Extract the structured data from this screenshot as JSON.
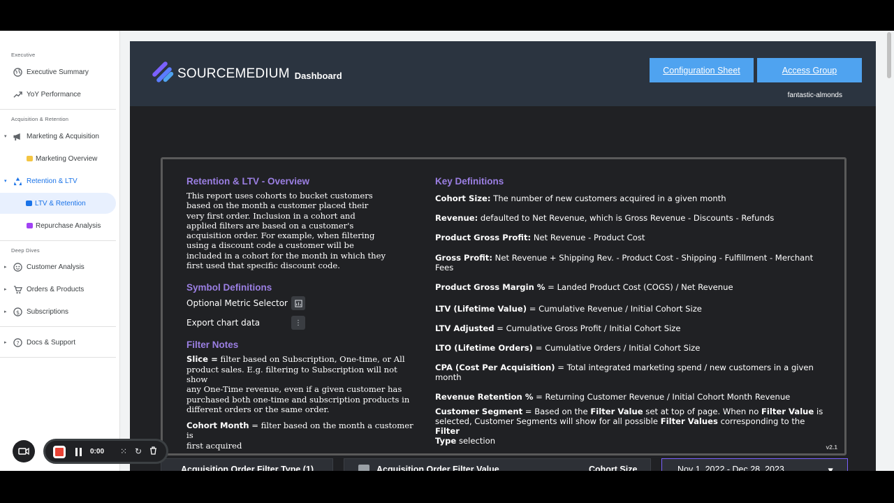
{
  "sidebar": {
    "sections": {
      "executive": "Executive",
      "acquisition": "Acquisition & Retention",
      "deep": "Deep Dives"
    },
    "items": {
      "exec_summary": "Executive Summary",
      "yoy": "YoY Performance",
      "mkt_acq": "Marketing & Acquisition",
      "mkt_overview": "Marketing Overview",
      "ret_ltv": "Retention & LTV",
      "ltv_ret": "LTV & Retention",
      "repurchase": "Repurchase Analysis",
      "customer": "Customer Analysis",
      "orders": "Orders & Products",
      "subs": "Subscriptions",
      "docs": "Docs & Support"
    }
  },
  "header": {
    "brand": "SOURCEMEDIUM",
    "brand_sub": "Dashboard",
    "config_btn": "Configuration Sheet",
    "access_btn": "Access Group",
    "account": "fantastic-almonds"
  },
  "overview": {
    "title": "Retention & LTV - Overview",
    "lines": [
      "This report uses cohorts to bucket customers",
      "based on the month a customer placed their",
      "very first order. Inclusion in a cohort and",
      "applied filters are based on a customer's",
      "acquisition order. For example, when filtering",
      "using a discount code a customer will be",
      "included in a cohort for the month in which they",
      "first used that specific discount code."
    ]
  },
  "symbols": {
    "title": "Symbol Definitions",
    "optional": "Optional Metric Selector",
    "export": "Export chart data"
  },
  "filters": {
    "title": "Filter Notes",
    "slice_label": "Slice =",
    "slice_lines": [
      " filter based on Subscription, One-time, or All",
      "product sales.  E.g. filtering to Subscription will not show",
      "any One-Time revenue, even if a given customer has",
      "purchased both one-time and subscription products in",
      "different orders or the same order."
    ],
    "cohort_label": "Cohort Month",
    "cohort_lines": [
      " = filter based on the month a customer is",
      "first acquired"
    ]
  },
  "definitions": {
    "title": "Key Definitions",
    "items": [
      {
        "term": "Cohort Size:",
        "text": " The number of new customers acquired in a given month"
      },
      {
        "term": "Revenue:",
        "text": " defaulted to Net Revenue, which is Gross Revenue - Discounts - Refunds"
      },
      {
        "term": "Product Gross Profit:",
        "text": " Net Revenue - Product Cost"
      },
      {
        "term": "Gross Profit:",
        "text": " Net Revenue + Shipping Rev. - Product Cost - Shipping - Fulfillment - Merchant Fees"
      },
      {
        "term": "Product Gross Margin %",
        "text": " = Landed Product Cost (COGS) / Net Revenue"
      },
      {
        "term": "LTV (Lifetime Value)",
        "text": "  = Cumulative Revenue / Initial Cohort Size"
      },
      {
        "term": "LTV Adjusted",
        "text": " = Cumulative Gross Profit / Initial Cohort Size"
      },
      {
        "term": "LTO (Lifetime Orders)",
        "text": " = Cumulative Orders  / Initial Cohort Size"
      },
      {
        "term": "CPA (Cost Per Acquisition)",
        "text": " = Total integrated marketing spend / new customers in a given month"
      },
      {
        "term": "Revenue Retention %",
        "text": " = Returning Customer Revenue / Initial Cohort Month Revenue"
      }
    ],
    "segment": {
      "term": "Customer Segment",
      "t1": " = Based on the ",
      "b1": "Filter Value",
      "t2": " set at top of page. When no ",
      "b2": "Filter Value",
      "t3": " is",
      "t4": "selected, Customer Segments will show for all possible ",
      "b3": "Filter Values",
      "t5": " corresponding to the ",
      "b4": "Filter",
      "b5": "Type",
      "t6": " selection"
    },
    "version": "v2.1"
  },
  "controls": {
    "filter_type": "Acquisition Order Filter Type (1)",
    "filter_value": "Acquisition Order Filter Value",
    "cohort_size": "Cohort Size",
    "date_range": "Nov 1, 2022 - Dec 28, 2023"
  },
  "recorder": {
    "time": "0:00"
  },
  "colors": {
    "accent_purple": "#9b7fe3",
    "button_blue": "#4fa3f0",
    "header_bg": "#2b3440",
    "active_blue": "#1a73e8",
    "record_red": "#ea4335"
  }
}
